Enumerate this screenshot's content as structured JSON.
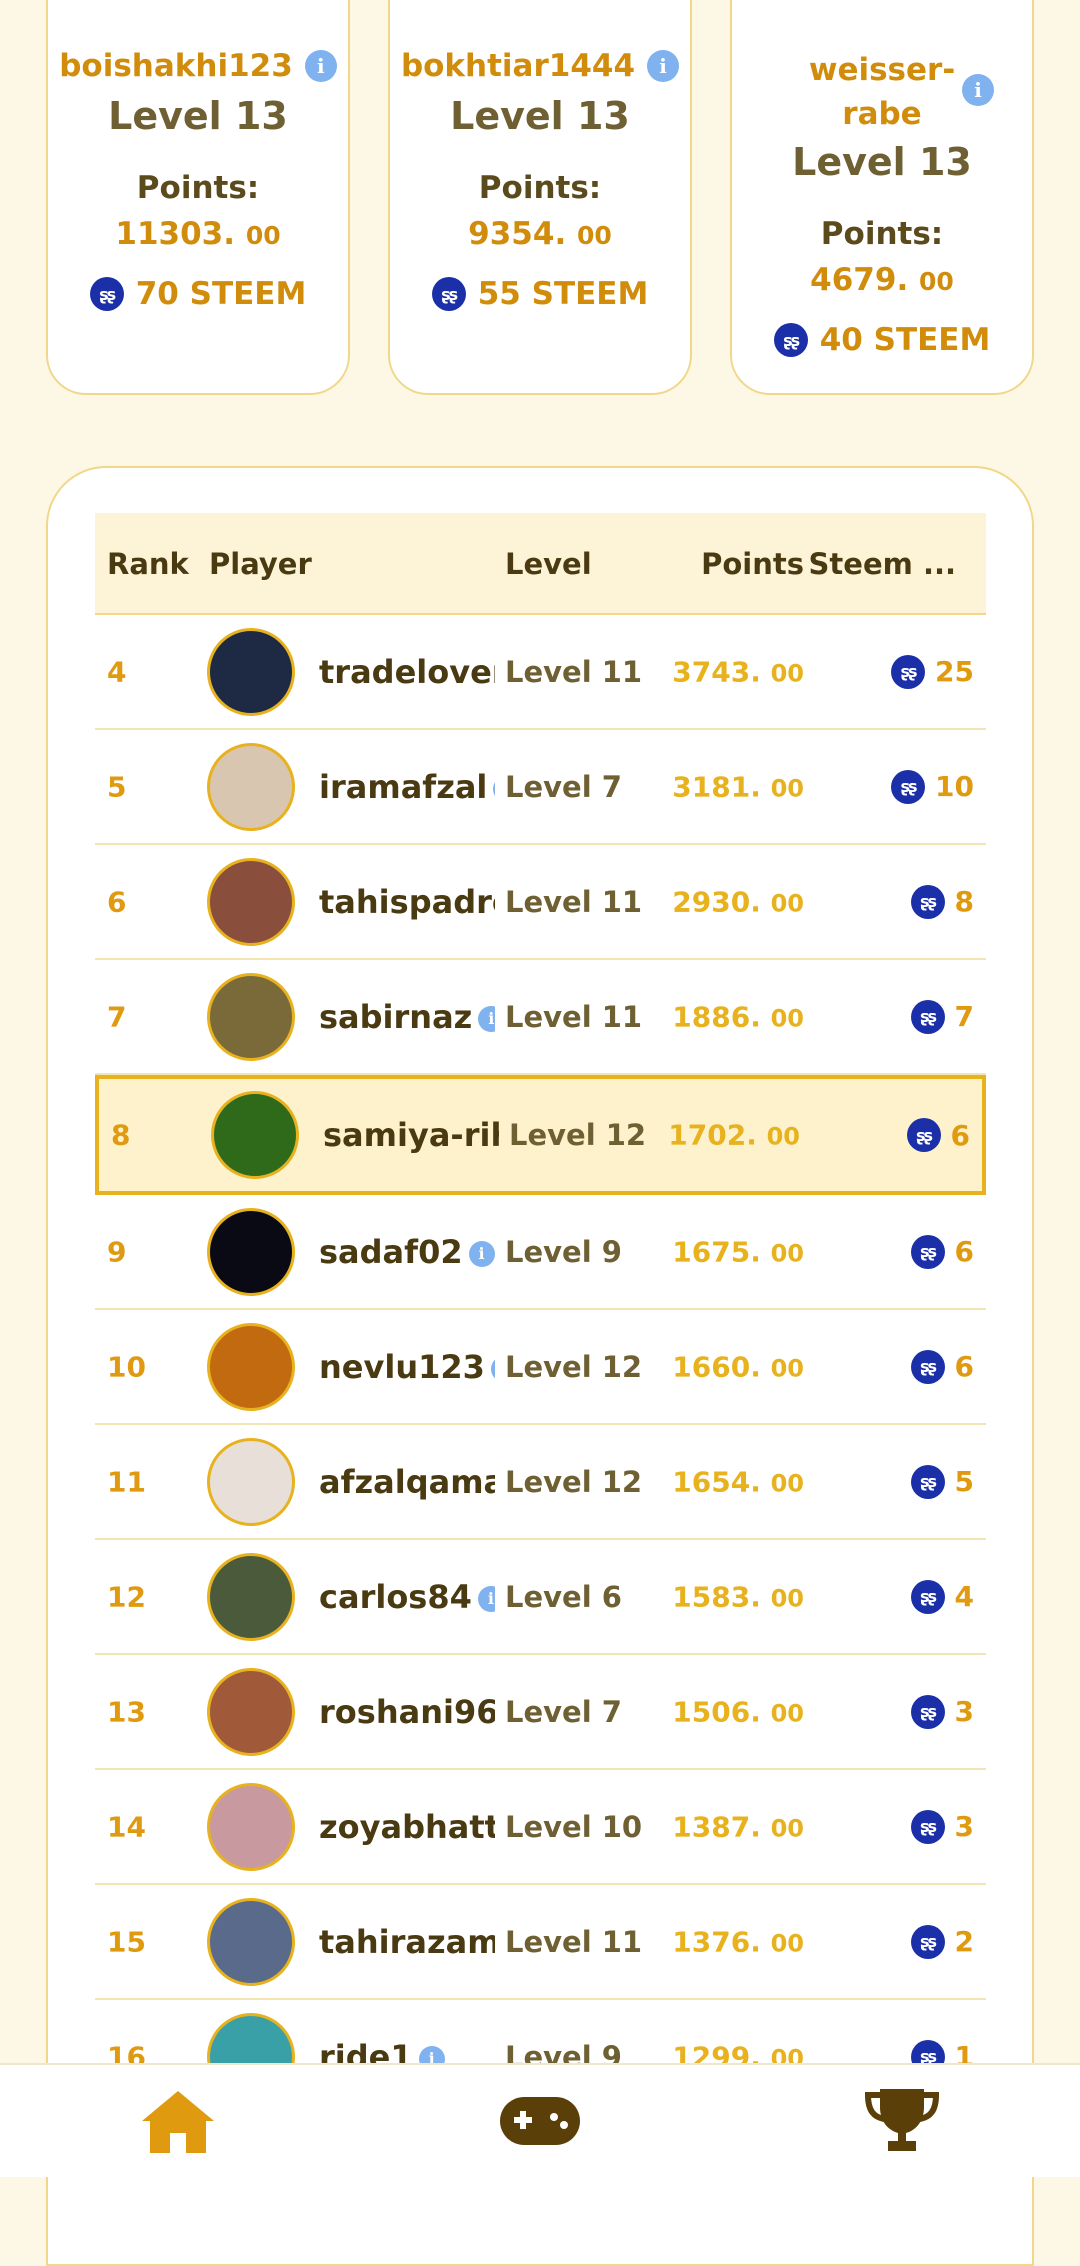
{
  "podium": [
    {
      "name": "boishakhi123",
      "level": "Level 13",
      "points_label": "Points:",
      "points_int": "11303.",
      "points_dec": "00",
      "steem": "70 STEEM",
      "ring_color": "#9a6aa8"
    },
    {
      "name": "bokhtiar1444",
      "level": "Level 13",
      "points_label": "Points:",
      "points_int": "9354.",
      "points_dec": "00",
      "steem": "55 STEEM",
      "ring_color": "#3a2a10"
    },
    {
      "name_line1": "weisser-",
      "name_line2": "rabe",
      "level": "Level 13",
      "points_label": "Points:",
      "points_int": "4679.",
      "points_dec": "00",
      "steem": "40 STEEM",
      "ring_color": "#222222"
    }
  ],
  "table": {
    "headers": {
      "rank": "Rank",
      "player": "Player",
      "level": "Level",
      "points": "Points",
      "steem": "Steem ..."
    },
    "rows": [
      {
        "rank": "4",
        "name": "tradelover",
        "level": "Level 11",
        "points_int": "3743.",
        "points_dec": "00",
        "steem": "25",
        "avatar_color": "#1e2a44"
      },
      {
        "rank": "5",
        "name": "iramafzal",
        "level": "Level 7",
        "points_int": "3181.",
        "points_dec": "00",
        "steem": "10",
        "avatar_color": "#d9c6b0"
      },
      {
        "rank": "6",
        "name": "tahispadro",
        "level": "Level 11",
        "points_int": "2930.",
        "points_dec": "00",
        "steem": "8",
        "avatar_color": "#8a4f3c"
      },
      {
        "rank": "7",
        "name": "sabirnaz",
        "level": "Level 11",
        "points_int": "1886.",
        "points_dec": "00",
        "steem": "7",
        "avatar_color": "#7a6a3a"
      },
      {
        "rank": "8",
        "name": "samiya-rih",
        "level": "Level 12",
        "points_int": "1702.",
        "points_dec": "00",
        "steem": "6",
        "avatar_color": "#2e6a1a"
      },
      {
        "rank": "9",
        "name": "sadaf02",
        "level": "Level 9",
        "points_int": "1675.",
        "points_dec": "00",
        "steem": "6",
        "avatar_color": "#0a0a14"
      },
      {
        "rank": "10",
        "name": "nevlu123",
        "level": "Level 12",
        "points_int": "1660.",
        "points_dec": "00",
        "steem": "6",
        "avatar_color": "#c26a10"
      },
      {
        "rank": "11",
        "name": "afzalqama",
        "level": "Level 12",
        "points_int": "1654.",
        "points_dec": "00",
        "steem": "5",
        "avatar_color": "#e8e0d8"
      },
      {
        "rank": "12",
        "name": "carlos84",
        "level": "Level 6",
        "points_int": "1583.",
        "points_dec": "00",
        "steem": "4",
        "avatar_color": "#4a5a3a"
      },
      {
        "rank": "13",
        "name": "roshani96",
        "level": "Level 7",
        "points_int": "1506.",
        "points_dec": "00",
        "steem": "3",
        "avatar_color": "#a05a3a"
      },
      {
        "rank": "14",
        "name": "zoyabhatti",
        "level": "Level 10",
        "points_int": "1387.",
        "points_dec": "00",
        "steem": "3",
        "avatar_color": "#c89aa0"
      },
      {
        "rank": "15",
        "name": "tahirazam",
        "level": "Level 11",
        "points_int": "1376.",
        "points_dec": "00",
        "steem": "2",
        "avatar_color": "#5a6a8a"
      },
      {
        "rank": "16",
        "name": "ride1",
        "level": "Level 9",
        "points_int": "1299.",
        "points_dec": "00",
        "steem": "1",
        "avatar_color": "#3aa0a8"
      }
    ],
    "highlight_rank": "8"
  },
  "nav": {
    "home": "home-icon",
    "games": "gamepad-icon",
    "leaderboard": "trophy-icon",
    "icon_color": "#5a3f08",
    "home_color": "#e09a10"
  },
  "colors": {
    "accent": "#e8b21e",
    "steem": "#1a2fa8",
    "info": "#7fb2ee"
  }
}
